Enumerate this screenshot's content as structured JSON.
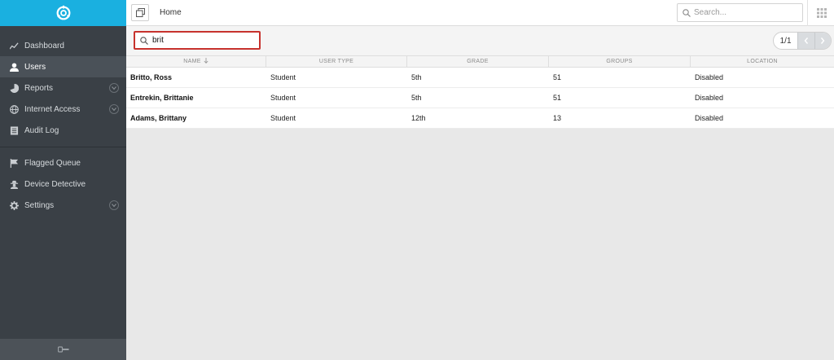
{
  "app": {
    "brand_color": "#1ab0e0"
  },
  "sidebar": {
    "items": [
      {
        "label": "Dashboard",
        "icon": "line-chart-icon",
        "active": false,
        "expandable": false
      },
      {
        "label": "Users",
        "icon": "user-icon",
        "active": true,
        "expandable": false
      },
      {
        "label": "Reports",
        "icon": "pie-chart-icon",
        "active": false,
        "expandable": true
      },
      {
        "label": "Internet Access",
        "icon": "globe-icon",
        "active": false,
        "expandable": true
      },
      {
        "label": "Audit Log",
        "icon": "log-icon",
        "active": false,
        "expandable": false
      }
    ],
    "items2": [
      {
        "label": "Flagged Queue",
        "icon": "flag-icon",
        "active": false,
        "expandable": false
      },
      {
        "label": "Device Detective",
        "icon": "detective-icon",
        "active": false,
        "expandable": false
      },
      {
        "label": "Settings",
        "icon": "gear-icon",
        "active": false,
        "expandable": true
      }
    ]
  },
  "header": {
    "breadcrumb": "Home",
    "search_placeholder": "Search..."
  },
  "toolbar": {
    "filter_value": "brit",
    "pager": "1/1"
  },
  "table": {
    "columns": [
      "NAME",
      "USER TYPE",
      "GRADE",
      "GROUPS",
      "LOCATION"
    ],
    "rows": [
      {
        "name": "Britto, Ross",
        "type": "Student",
        "grade": "5th",
        "groups": "51",
        "location": "Disabled"
      },
      {
        "name": "Entrekin, Brittanie",
        "type": "Student",
        "grade": "5th",
        "groups": "51",
        "location": "Disabled"
      },
      {
        "name": "Adams, Brittany",
        "type": "Student",
        "grade": "12th",
        "groups": "13",
        "location": "Disabled"
      }
    ]
  }
}
